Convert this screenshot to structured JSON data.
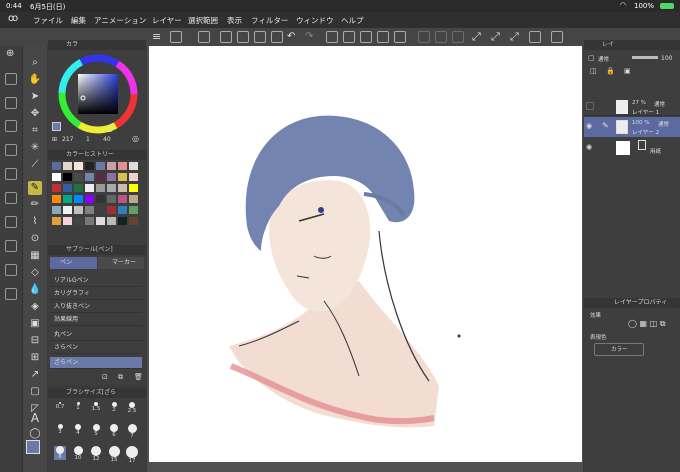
{
  "status": {
    "time": "0:44",
    "date": "6月5日(日)",
    "battery": "100%"
  },
  "menu": [
    "ファイル",
    "編集",
    "アニメーション",
    "レイヤー",
    "選択範囲",
    "表示",
    "フィルター",
    "ウィンドウ",
    "ヘルプ"
  ],
  "color_panel": {
    "tab": "カラ",
    "values": [
      "217",
      "1",
      "40"
    ]
  },
  "history_panel": {
    "title": "カラーヒストリー"
  },
  "subtool_panel": {
    "title": "サブツール[ペン]",
    "tabs": [
      "ペン",
      "マーカー"
    ],
    "items": [
      "リアルGペン",
      "カリグラフィ",
      "入り抜きペン",
      "効果線用",
      "丸ペン",
      "さらペン",
      "ざらペン"
    ],
    "selected": 6
  },
  "brush_panel": {
    "title": "ブラシサイズ[ざら",
    "row1": [
      "0.7",
      "1",
      "1.5",
      "2",
      "2.5"
    ],
    "row2": [
      "3",
      "4",
      "5",
      "6",
      "7"
    ],
    "row3": [
      "8",
      "10",
      "12",
      "15",
      "17"
    ]
  },
  "layer_panel": {
    "tab": "レイ",
    "blend": "通常",
    "opacity": "100",
    "layers": [
      {
        "pct": "27 %",
        "mode": "通常",
        "name": "レイヤー 1"
      },
      {
        "pct": "100 %",
        "mode": "通常",
        "name": "レイヤー 2"
      },
      {
        "pct": "",
        "mode": "",
        "name": "用紙"
      }
    ]
  },
  "property_panel": {
    "title": "レイヤープロパティ",
    "effect_label": "効果",
    "expr_label": "表現色",
    "expr_value": "カラー"
  },
  "colors": {
    "accent": "#6a7aa8",
    "hair": "#7484b0",
    "skin": "#f3dcd2"
  }
}
